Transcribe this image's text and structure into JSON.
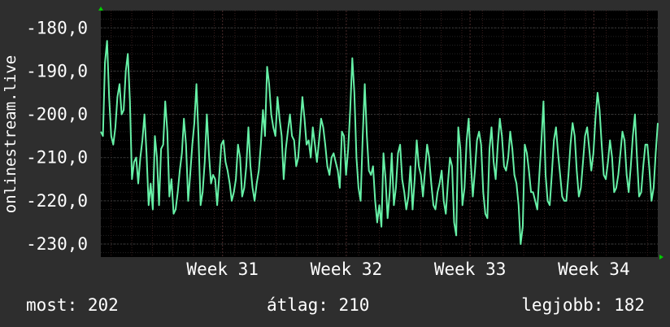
{
  "chart_data": {
    "type": "line",
    "ylabel": "onlinestream.live",
    "ylim": [
      -233,
      -176
    ],
    "y_ticks": [
      -180,
      -190,
      -200,
      -210,
      -220,
      -230
    ],
    "y_tick_labels": [
      "-180,0",
      "-190,0",
      "-200,0",
      "-210,0",
      "-220,0",
      "-230,0"
    ],
    "x_tick_labels": [
      "Week 31",
      "Week 32",
      "Week 33",
      "Week 34"
    ],
    "x_tick_positions": [
      29.5,
      59.5,
      89.5,
      119.5
    ],
    "xlim": [
      0,
      135
    ],
    "grid": true,
    "series": [
      {
        "values": [
          -204,
          -205,
          -188,
          -183,
          -196,
          -205,
          -207,
          -203,
          -196,
          -193,
          -200,
          -199,
          -190,
          -186,
          -197,
          -215,
          -211,
          -210,
          -216,
          -210,
          -206,
          -200,
          -209,
          -221,
          -216,
          -222,
          -205,
          -210,
          -221,
          -208,
          -207,
          -197,
          -204,
          -219,
          -215,
          -223,
          -222,
          -218,
          -213,
          -209,
          -201,
          -207,
          -220,
          -214,
          -207,
          -202,
          -193,
          -205,
          -221,
          -218,
          -211,
          -200,
          -209,
          -216,
          -214,
          -215,
          -221,
          -214,
          -207,
          -206,
          -211,
          -213,
          -216,
          -220,
          -218,
          -215,
          -207,
          -210,
          -219,
          -217,
          -212,
          -203,
          -212,
          -217,
          -220,
          -216,
          -213,
          -207,
          -199,
          -205,
          -189,
          -193,
          -200,
          -203,
          -205,
          -196,
          -201,
          -205,
          -215,
          -208,
          -204,
          -200,
          -205,
          -206,
          -212,
          -210,
          -203,
          -196,
          -201,
          -207,
          -206,
          -210,
          -203,
          -207,
          -211,
          -206,
          -201,
          -203,
          -207,
          -212,
          -214,
          -210,
          -209,
          -211,
          -213,
          -217,
          -204,
          -205,
          -214,
          -208,
          -199,
          -187,
          -195,
          -210,
          -217,
          -220,
          -205,
          -193,
          -205,
          -213,
          -214,
          -212,
          -220,
          -225,
          -221,
          -226,
          -209,
          -215,
          -224,
          -218,
          -209,
          -221,
          -217,
          -209,
          -207,
          -215,
          -218,
          -222,
          -219,
          -212,
          -222,
          -215,
          -206,
          -212,
          -214,
          -219,
          -213,
          -207,
          -210,
          -216,
          -221,
          -222,
          -218,
          -216,
          -213,
          -220,
          -223,
          -216,
          -210,
          -212,
          -225,
          -228,
          -203,
          -208,
          -221,
          -217,
          -206,
          -201,
          -211,
          -219,
          -213,
          -206,
          -204,
          -207,
          -218,
          -223,
          -224,
          -208,
          -203,
          -211,
          -215,
          -207,
          -201,
          -205,
          -212,
          -213,
          -210,
          -204,
          -208,
          -214,
          -216,
          -221,
          -230,
          -226,
          -207,
          -209,
          -213,
          -218,
          -218,
          -220,
          -222,
          -214,
          -206,
          -197,
          -214,
          -220,
          -221,
          -214,
          -206,
          -203,
          -209,
          -214,
          -219,
          -220,
          -220,
          -214,
          -207,
          -202,
          -205,
          -213,
          -219,
          -217,
          -211,
          -205,
          -203,
          -208,
          -213,
          -209,
          -201,
          -195,
          -199,
          -207,
          -214,
          -215,
          -211,
          -206,
          -210,
          -218,
          -217,
          -214,
          -209,
          -204,
          -206,
          -214,
          -218,
          -212,
          -205,
          -200,
          -210,
          -219,
          -218,
          -212,
          -207,
          -207,
          -213,
          -220,
          -217,
          -209,
          -202
        ]
      }
    ]
  },
  "summary": {
    "current_label": "most: 202",
    "average_label": "átlag: 210",
    "best_label": "legjobb: 182"
  },
  "colors": {
    "background": "#2e2e2e",
    "plot_background": "#000000",
    "grid_major": "#3a3a3a",
    "grid_minor": "#242424",
    "line": "#66f0a6",
    "text": "#ffffff",
    "axis_arrow": "#00cc00"
  }
}
